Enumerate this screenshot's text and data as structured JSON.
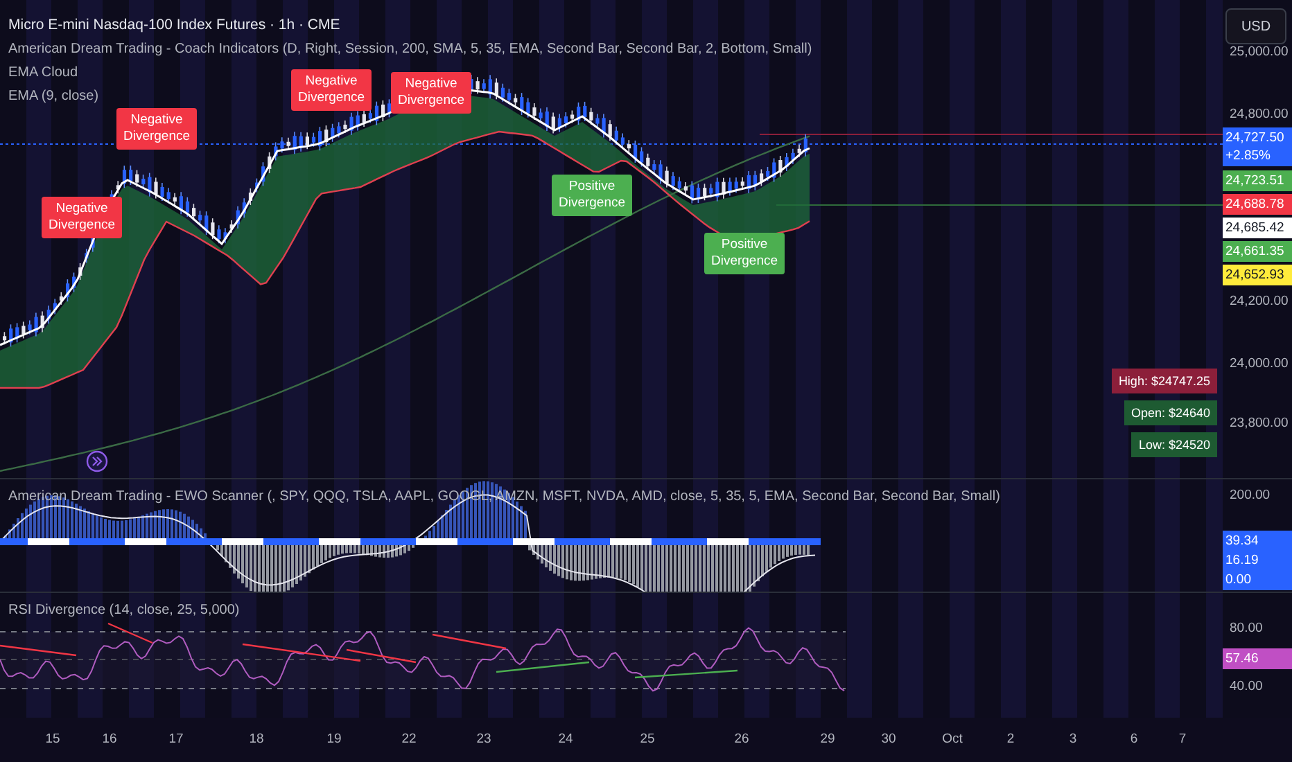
{
  "main_pane": {
    "title": "Micro E-mini Nasdaq-100 Index Futures · 1h · CME",
    "indicators": [
      "American Dream Trading - Coach Indicators (D, Right, Session, 200, SMA, 5, 35, EMA, Second Bar, Second Bar, 2, Bottom, Small)",
      "EMA Cloud",
      "EMA (9, close)"
    ],
    "signals": [
      {
        "kind": "negative",
        "text": "Negative Divergence"
      },
      {
        "kind": "negative",
        "text": "Negative Divergence"
      },
      {
        "kind": "negative",
        "text": "Negative Divergence"
      },
      {
        "kind": "negative",
        "text": "Negative Divergence"
      },
      {
        "kind": "positive",
        "text": "Positive Divergence"
      },
      {
        "kind": "positive",
        "text": "Positive Divergence"
      }
    ],
    "info_boxes": [
      {
        "text": "High: $24747.25",
        "color": "#8c1f3a"
      },
      {
        "text": "Open: $24640",
        "color": "#1e5b32"
      },
      {
        "text": "Low: $24520",
        "color": "#1e5b32"
      }
    ],
    "currency": "USD",
    "axis_labels": [
      "25,000.00",
      "24,800.00",
      "24,200.00",
      "24,000.00",
      "23,800.00"
    ],
    "price_tags": [
      {
        "text": "24,727.50",
        "subtext": "+2.85%",
        "color": "#2962ff"
      },
      {
        "text": "24,723.51",
        "color": "#4caf50"
      },
      {
        "text": "24,688.78",
        "color": "#f23645"
      },
      {
        "text": "24,685.42",
        "color": "#ffffff"
      },
      {
        "text": "24,661.35",
        "color": "#4caf50"
      },
      {
        "text": "24,652.93",
        "color": "#ffeb3b"
      }
    ]
  },
  "ewo_pane": {
    "title": "American Dream Trading - EWO Scanner (, SPY, QQQ, TSLA, AAPL, GOOGL, AMZN, MSFT, NVDA, AMD, close, 5, 35, 5, EMA, Second Bar, Second Bar, Small)",
    "axis_labels": [
      "200.00"
    ],
    "value_tags": [
      {
        "text": "39.34",
        "color": "#2962ff"
      },
      {
        "text": "16.19",
        "color": "#2962ff"
      },
      {
        "text": "0.00",
        "color": "#2962ff"
      }
    ]
  },
  "rsi_pane": {
    "title": "RSI Divergence (14, close, 25, 5,000)",
    "axis_labels": [
      "80.00",
      "40.00"
    ],
    "value_tags": [
      {
        "text": "57.46",
        "color": "#c04fc4"
      }
    ]
  },
  "time_axis": {
    "labels": [
      "15",
      "16",
      "17",
      "18",
      "19",
      "22",
      "23",
      "24",
      "25",
      "26",
      "29",
      "30",
      "Oct",
      "2",
      "3",
      "6",
      "7"
    ]
  }
}
